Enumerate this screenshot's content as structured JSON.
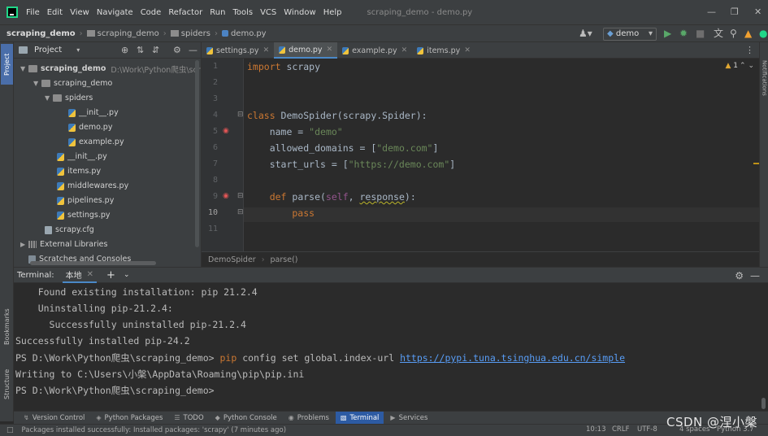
{
  "menubar": {
    "items": [
      "File",
      "Edit",
      "View",
      "Navigate",
      "Code",
      "Refactor",
      "Run",
      "Tools",
      "VCS",
      "Window",
      "Help"
    ],
    "window_title": "scraping_demo - demo.py"
  },
  "navbar": {
    "crumbs": [
      "scraping_demo",
      "scraping_demo",
      "spiders",
      "demo.py"
    ],
    "run_config": "demo"
  },
  "left_stripe": {
    "project": "Project",
    "bookmarks": "Bookmarks",
    "structure": "Structure"
  },
  "right_stripe": {
    "notifications": "Notifications"
  },
  "project": {
    "title": "Project",
    "tree": [
      {
        "label": "scraping_demo",
        "path": "D:\\Work\\Python爬虫\\scrapi",
        "kind": "folder",
        "level": 0,
        "expanded": true,
        "bold": true
      },
      {
        "label": "scraping_demo",
        "kind": "folder",
        "level": 1,
        "expanded": true
      },
      {
        "label": "spiders",
        "kind": "folder",
        "level": 2,
        "expanded": true
      },
      {
        "label": "__init__.py",
        "kind": "py",
        "level": 3
      },
      {
        "label": "demo.py",
        "kind": "py",
        "level": 3
      },
      {
        "label": "example.py",
        "kind": "py",
        "level": 3
      },
      {
        "label": "__init__.py",
        "kind": "py",
        "level": 2
      },
      {
        "label": "items.py",
        "kind": "py",
        "level": 2
      },
      {
        "label": "middlewares.py",
        "kind": "py",
        "level": 2
      },
      {
        "label": "pipelines.py",
        "kind": "py",
        "level": 2
      },
      {
        "label": "settings.py",
        "kind": "py",
        "level": 2
      },
      {
        "label": "scrapy.cfg",
        "kind": "cfg",
        "level": 1
      },
      {
        "label": "External Libraries",
        "kind": "lib",
        "level": 0,
        "expanded": false
      },
      {
        "label": "Scratches and Consoles",
        "kind": "scratch",
        "level": 0
      }
    ]
  },
  "editor_tabs": [
    {
      "label": "settings.py",
      "active": false
    },
    {
      "label": "demo.py",
      "active": true
    },
    {
      "label": "example.py",
      "active": false
    },
    {
      "label": "items.py",
      "active": false
    }
  ],
  "editor": {
    "line_numbers": [
      "1",
      "2",
      "3",
      "4",
      "5",
      "6",
      "7",
      "8",
      "9",
      "10",
      "11"
    ],
    "current_line": "10",
    "warnings": "1",
    "code": {
      "l1_kw": "import",
      "l1_rest": " scrapy",
      "l4_kw": "class",
      "l4_rest": " DemoSpider(scrapy.Spider):",
      "l5_pre": "    name = ",
      "l5_str": "\"demo\"",
      "l6_pre": "    allowed_domains = [",
      "l6_str": "\"demo.com\"",
      "l6_post": "]",
      "l7_pre": "    start_urls = [",
      "l7_str": "\"https://demo.com\"",
      "l7_post": "]",
      "l9_kw": "    def",
      "l9_fn": " parse(",
      "l9_self": "self",
      "l9_mid": ", ",
      "l9_arg": "response",
      "l9_post": "):",
      "l10_kw": "        pass"
    }
  },
  "breadcrumb": [
    "DemoSpider",
    "parse()"
  ],
  "terminal": {
    "label": "Terminal:",
    "tab": "本地",
    "lines": {
      "l1": "    Found existing installation: pip 21.2.4",
      "l2": "    Uninstalling pip-21.2.4:",
      "l3": "      Successfully uninstalled pip-21.2.4",
      "l4": "Successfully installed pip-24.2",
      "l5_prompt": "PS D:\\Work\\Python爬虫\\scraping_demo> ",
      "l5_cmd": "pip",
      "l5_args": " config set global.index-url ",
      "l5_url": "https://pypi.tuna.tsinghua.edu.cn/simple",
      "l6": "Writing to C:\\Users\\小槃\\AppData\\Roaming\\pip\\pip.ini",
      "l7": "PS D:\\Work\\Python爬虫\\scraping_demo> "
    }
  },
  "tool_windows": [
    {
      "label": "Version Control",
      "icon": "vcs-icon",
      "active": false
    },
    {
      "label": "Python Packages",
      "icon": "packages-icon",
      "active": false
    },
    {
      "label": "TODO",
      "icon": "todo-icon",
      "active": false
    },
    {
      "label": "Python Console",
      "icon": "console-icon",
      "active": false
    },
    {
      "label": "Problems",
      "icon": "problems-icon",
      "active": false
    },
    {
      "label": "Terminal",
      "icon": "terminal-icon",
      "active": true
    },
    {
      "label": "Services",
      "icon": "services-icon",
      "active": false
    }
  ],
  "status": {
    "message": "Packages installed successfully: Installed packages: 'scrapy' (7 minutes ago)",
    "position": "10:13",
    "line_sep": "CRLF",
    "encoding": "UTF-8",
    "indent": "4 spaces",
    "interpreter": "Python 3.7"
  },
  "watermark": "CSDN @涅小槃",
  "colors": {
    "keyword": "#cc7832",
    "string": "#6a8759",
    "self": "#94558d",
    "link": "#589df6",
    "accent": "#2d5ba3"
  }
}
